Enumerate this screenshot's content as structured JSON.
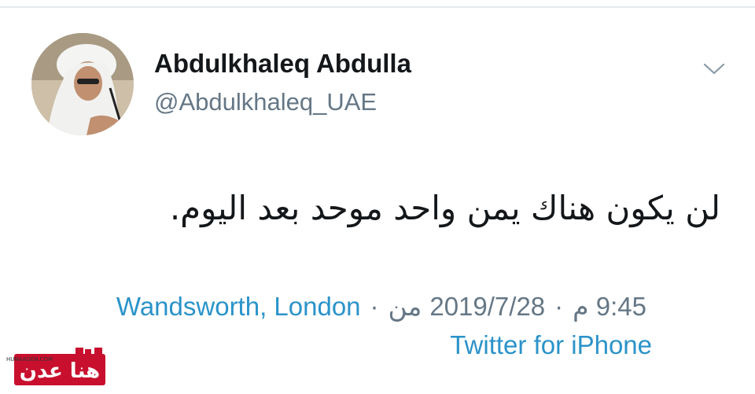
{
  "tweet": {
    "display_name": "Abdulkhaleq Abdulla",
    "handle": "@Abdulkhaleq_UAE",
    "text": "لن يكون هناك يمن واحد موحد بعد اليوم.",
    "location": "Wandsworth, London",
    "from_label": "من",
    "date": "2019/7/28",
    "time": "9:45 م",
    "separator": "·",
    "client": "Twitter for iPhone"
  },
  "icons": {
    "more_menu": "chevron-down-icon",
    "avatar": "profile-photo"
  },
  "watermark": {
    "logo_text": "هنا عدن",
    "url": "HUNAADEN.COM"
  },
  "colors": {
    "link": "#2b93c9",
    "secondary_text": "#657786",
    "primary_text": "#14171a",
    "watermark_red": "#c8102e"
  }
}
